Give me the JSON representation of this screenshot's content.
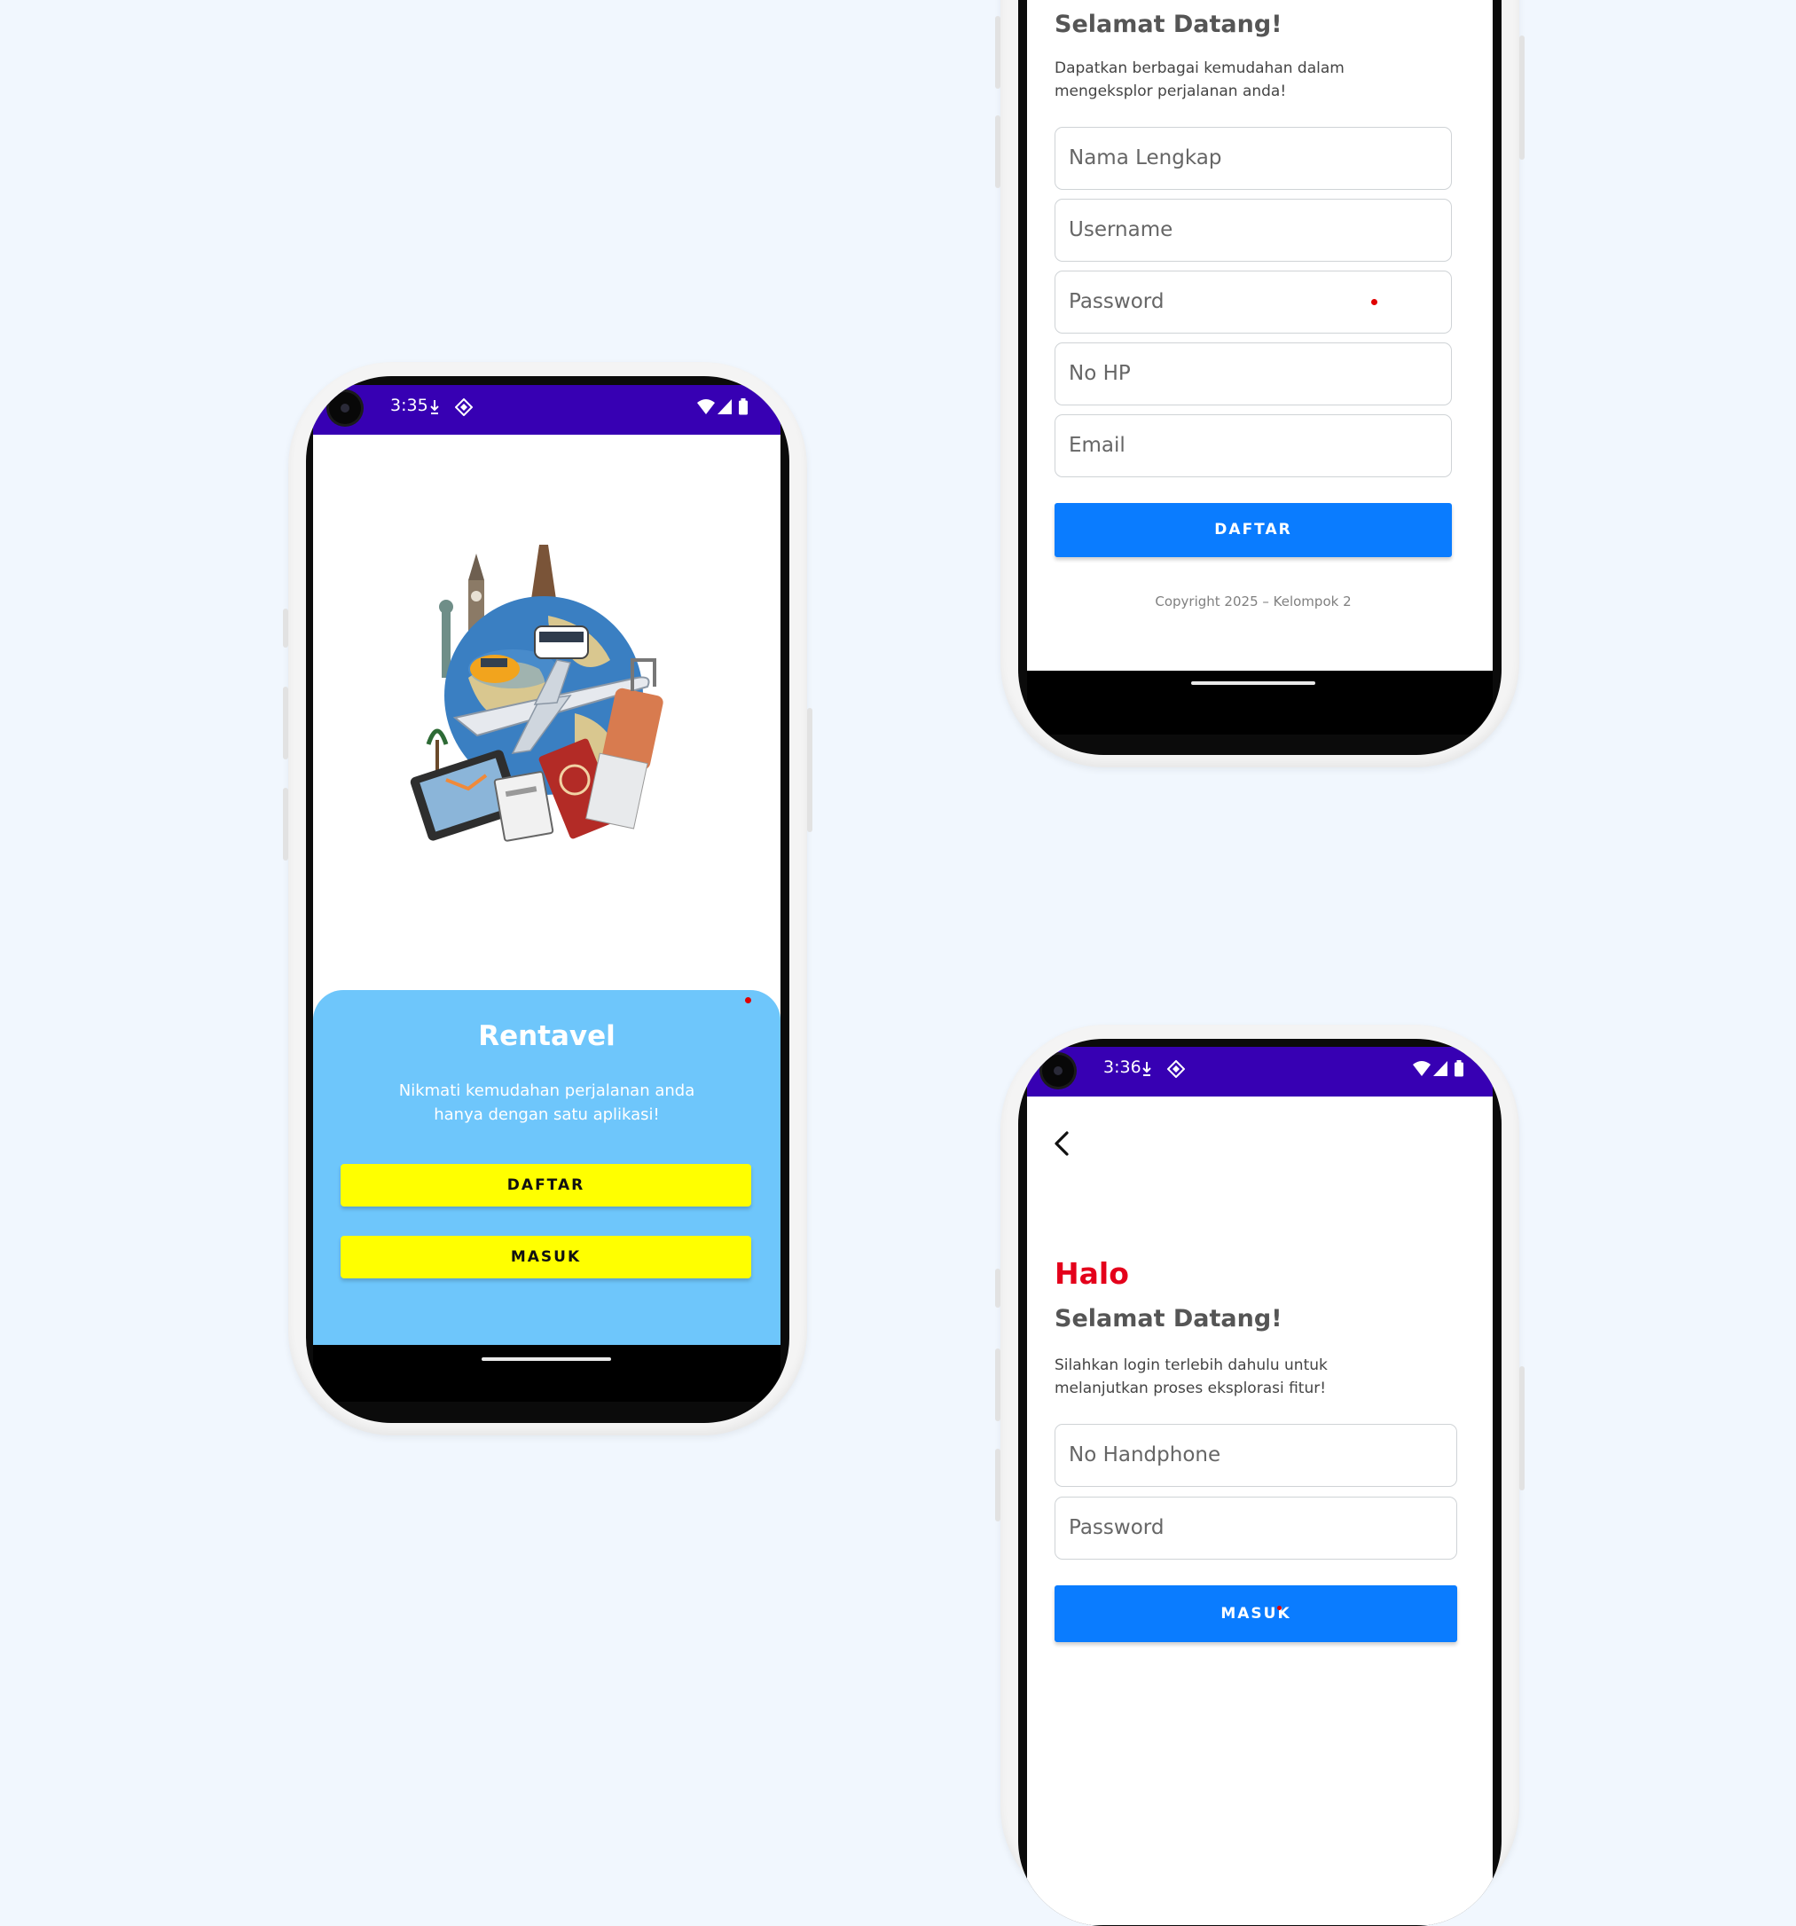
{
  "welcome_screen": {
    "status": {
      "time": "3:35"
    },
    "app_name": "Rentavel",
    "tagline_line1": "Nikmati kemudahan perjalanan anda",
    "tagline_line2": "hanya dengan satu aplikasi!",
    "register_button": "DAFTAR",
    "login_button": "MASUK"
  },
  "register_screen": {
    "greeting": "Selamat Datang!",
    "desc_line1": "Dapatkan berbagai kemudahan dalam",
    "desc_line2": "mengeksplor perjalanan anda!",
    "fields": {
      "full_name": "Nama Lengkap",
      "username": "Username",
      "password": "Password",
      "phone": "No HP",
      "email": "Email"
    },
    "submit_button": "DAFTAR",
    "copyright": "Copyright 2025 – Kelompok 2"
  },
  "login_screen": {
    "status": {
      "time": "3:36"
    },
    "hello": "Halo",
    "greeting": "Selamat Datang!",
    "desc_line1": "Silahkan login terlebih dahulu untuk",
    "desc_line2": "melanjutkan proses eksplorasi fitur!",
    "fields": {
      "phone": "No Handphone",
      "password": "Password"
    },
    "submit_button": "MASUK"
  },
  "colors": {
    "status_bar": "#3700b3",
    "sheet": "#6ec6fb",
    "yellow_button": "#ffff00",
    "blue_button": "#0a7cff",
    "halo_red": "#e4001b"
  }
}
